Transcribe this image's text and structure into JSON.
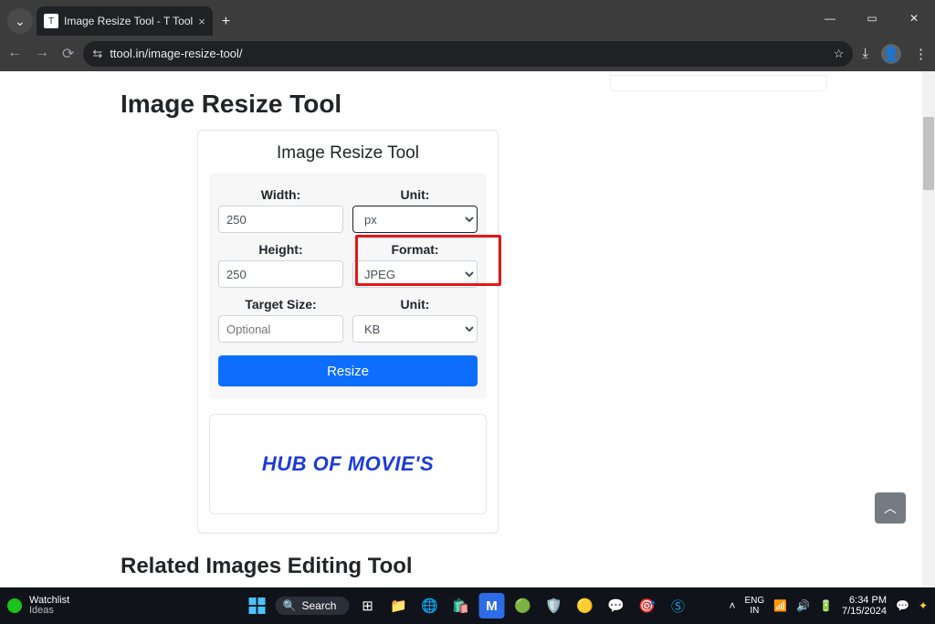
{
  "browser": {
    "tab_title": "Image Resize Tool - T Tool",
    "url": "ttool.in/image-resize-tool/"
  },
  "page": {
    "heading": "Image Resize Tool",
    "card_title": "Image Resize Tool",
    "form": {
      "width": {
        "label": "Width:",
        "value": "250"
      },
      "height": {
        "label": "Height:",
        "value": "250"
      },
      "unit1": {
        "label": "Unit:",
        "value": "px"
      },
      "format": {
        "label": "Format:",
        "value": "JPEG"
      },
      "target": {
        "label": "Target Size:",
        "placeholder": "Optional"
      },
      "unit2": {
        "label": "Unit:",
        "value": "KB"
      },
      "submit": "Resize"
    },
    "ad_text": "HUB OF MOVIE'S",
    "next_heading": "Related Images Editing Tool"
  },
  "taskbar": {
    "widget_title": "Watchlist",
    "widget_sub": "Ideas",
    "search": "Search",
    "lang_top": "ENG",
    "lang_bot": "IN",
    "time": "6:34 PM",
    "date": "7/15/2024"
  }
}
